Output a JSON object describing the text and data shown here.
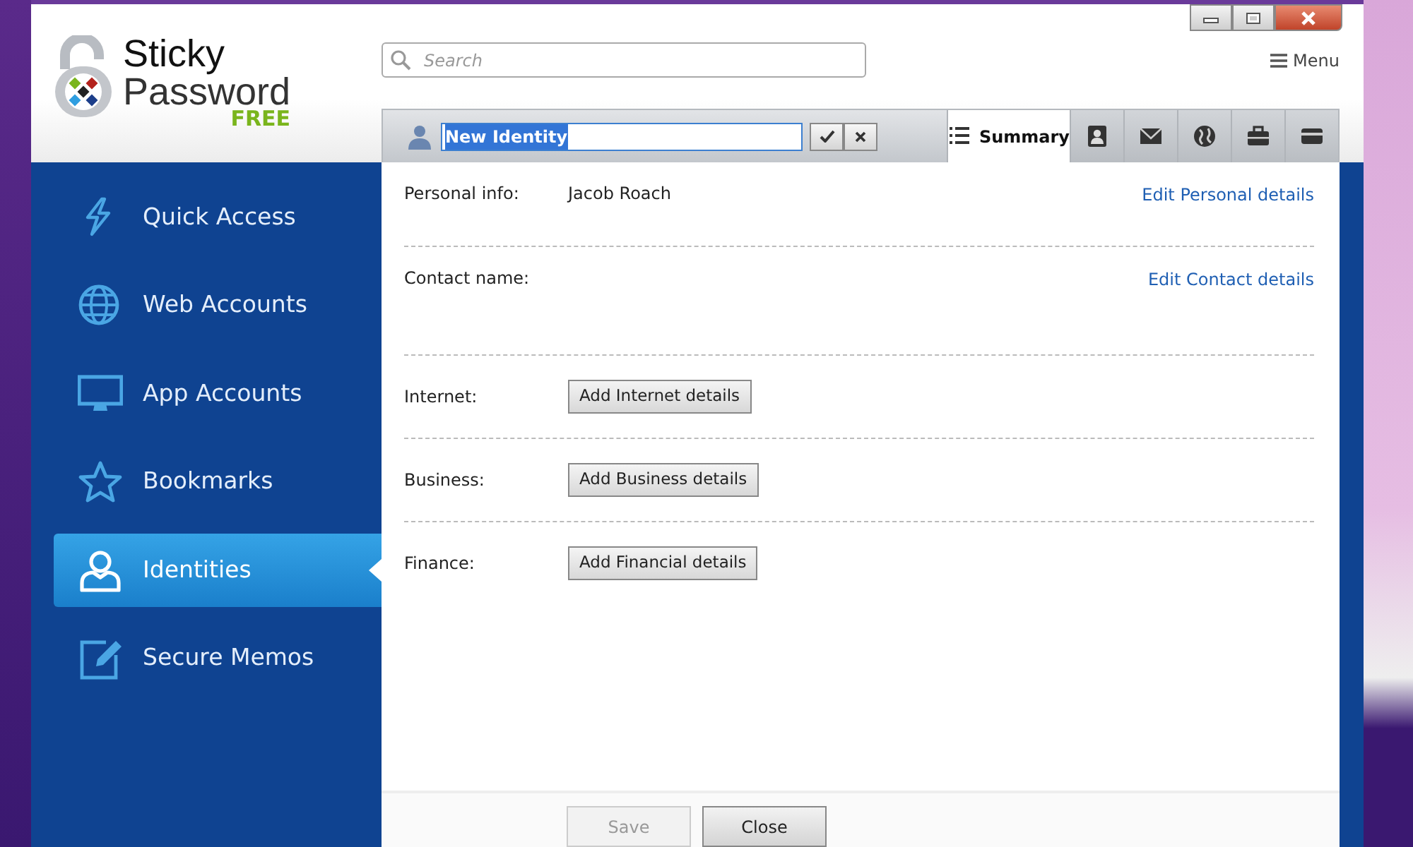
{
  "logo": {
    "line1": "Sticky",
    "line2": "Password",
    "edition": "FREE"
  },
  "search": {
    "placeholder": "Search"
  },
  "menu": {
    "label": "Menu"
  },
  "sidebar": {
    "items": [
      {
        "kind": "quick",
        "label": "Quick Access",
        "selected": false
      },
      {
        "kind": "web",
        "label": "Web Accounts",
        "selected": false
      },
      {
        "kind": "app",
        "label": "App Accounts",
        "selected": false
      },
      {
        "kind": "bookmark",
        "label": "Bookmarks",
        "selected": false
      },
      {
        "kind": "identity",
        "label": "Identities",
        "selected": true
      },
      {
        "kind": "memo",
        "label": "Secure Memos",
        "selected": false
      }
    ]
  },
  "identity": {
    "name": "New Identity",
    "name_selected": true
  },
  "tabs": [
    {
      "kind": "summary",
      "label": "Summary",
      "selected": true
    },
    {
      "kind": "contact",
      "selected": false
    },
    {
      "kind": "mail",
      "selected": false
    },
    {
      "kind": "internet",
      "selected": false
    },
    {
      "kind": "business",
      "selected": false
    },
    {
      "kind": "card",
      "selected": false
    }
  ],
  "sections": [
    {
      "label": "Personal info:",
      "value": "Jacob  Roach",
      "link": "Edit Personal details"
    },
    {
      "label": "Contact name:",
      "link": "Edit Contact details"
    },
    {
      "label": "Internet:",
      "button": "Add Internet details"
    },
    {
      "label": "Business:",
      "button": "Add Business details"
    },
    {
      "label": "Finance:",
      "button": "Add Financial details"
    }
  ],
  "footer_buttons": [
    {
      "label": "Save",
      "disabled": true
    },
    {
      "label": "Close",
      "disabled": false
    }
  ]
}
